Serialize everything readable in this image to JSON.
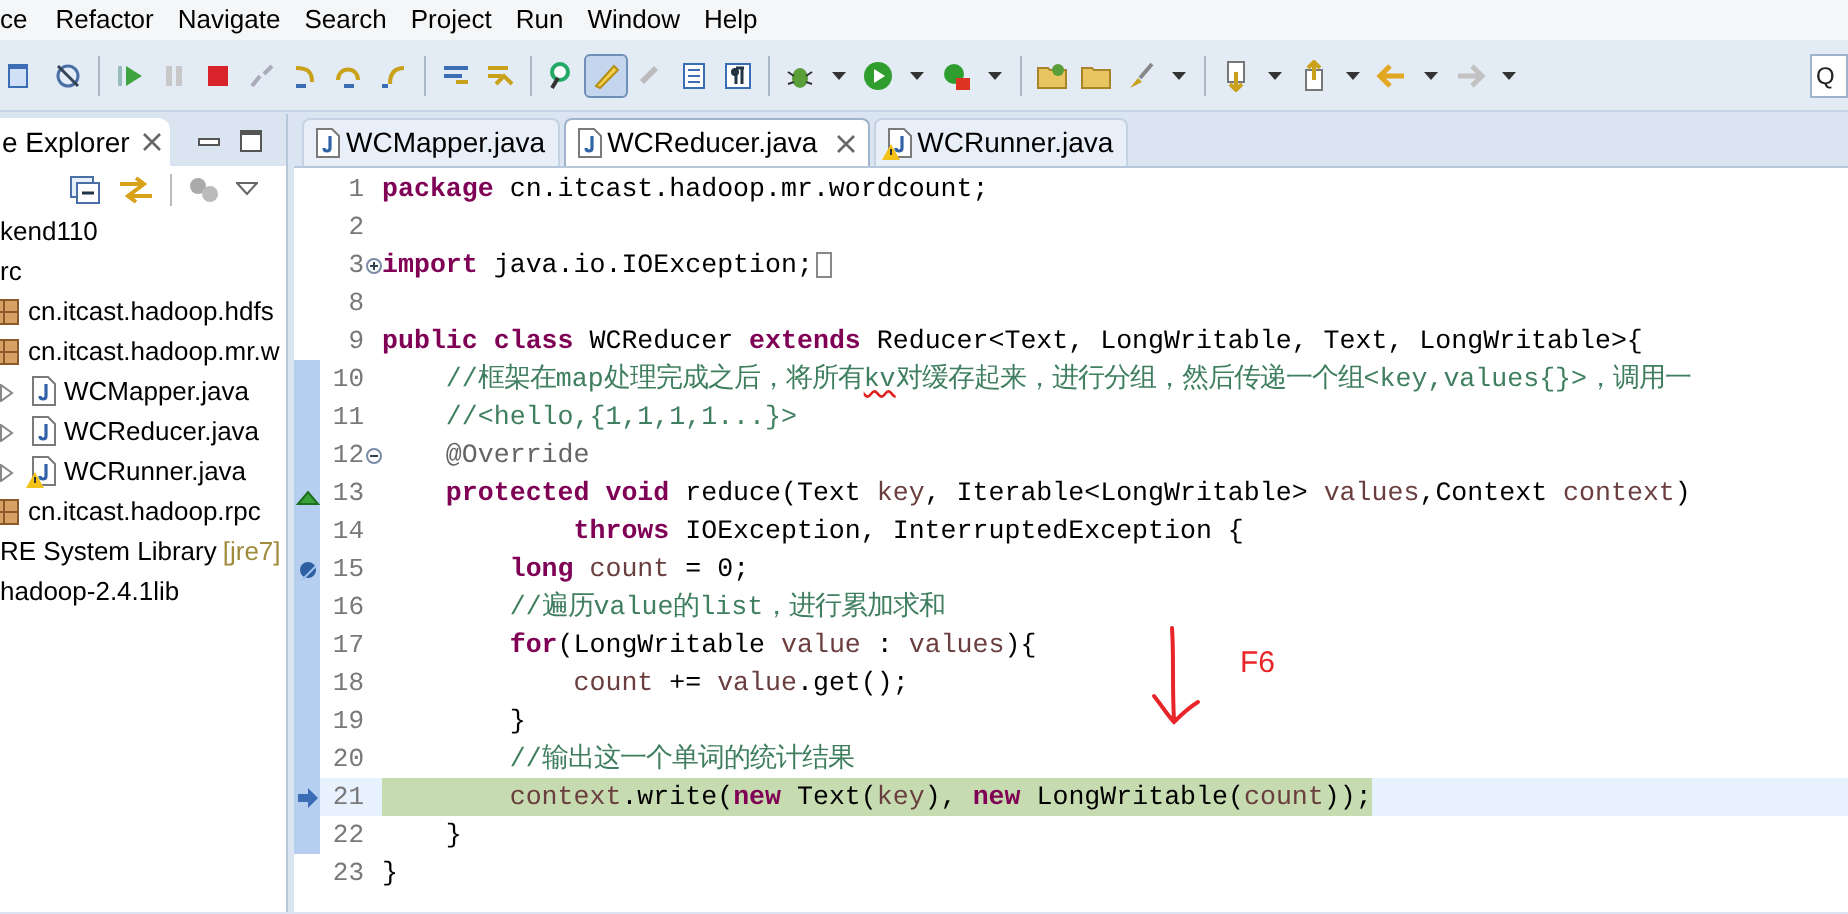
{
  "menu": [
    "ce",
    "Refactor",
    "Navigate",
    "Search",
    "Project",
    "Run",
    "Window",
    "Help"
  ],
  "toolbar": [
    {
      "selected": false
    },
    {
      "selected": false
    },
    {
      "selected": false
    },
    {
      "selected": false
    },
    {
      "selected": false
    },
    {
      "selected": false
    },
    {
      "selected": false
    },
    {
      "selected": false
    },
    {
      "selected": false
    },
    {
      "selected": false
    },
    {
      "selected": false
    },
    {
      "selected": false
    },
    {
      "selected": true
    },
    {
      "selected": false
    },
    {
      "selected": false
    },
    {
      "selected": false
    },
    {
      "selected": false
    },
    {
      "selected": false
    },
    {
      "selected": false
    },
    {
      "selected": false
    },
    {
      "selected": false
    },
    {
      "selected": false
    },
    {
      "selected": false
    },
    {
      "selected": false
    },
    {
      "selected": false
    },
    {
      "selected": false
    }
  ],
  "quick_access": {
    "placeholder": "Q"
  },
  "explorer": {
    "title": "e Explorer",
    "tree": [
      {
        "label": "kend110",
        "children": [
          {
            "label": "rc",
            "children": [
              {
                "label": "cn.itcast.hadoop.hdfs",
                "kind": "package"
              },
              {
                "label": "cn.itcast.hadoop.mr.w",
                "kind": "package",
                "children": [
                  {
                    "label": "WCMapper.java",
                    "kind": "file",
                    "expanded": false,
                    "warning": false
                  },
                  {
                    "label": "WCReducer.java",
                    "kind": "file",
                    "expanded": false,
                    "warning": false
                  },
                  {
                    "label": "WCRunner.java",
                    "kind": "file",
                    "expanded": false,
                    "warning": true
                  }
                ]
              },
              {
                "label": "cn.itcast.hadoop.rpc",
                "kind": "package"
              }
            ]
          },
          {
            "label": "RE System Library",
            "decoration": "[jre7]"
          },
          {
            "label": "hadoop-2.4.1lib"
          }
        ]
      }
    ]
  },
  "editor_tabs": [
    {
      "label": "WCMapper.java",
      "selected": false,
      "warning": false
    },
    {
      "label": "WCReducer.java",
      "selected": true,
      "warning": false
    },
    {
      "label": "WCRunner.java",
      "selected": false,
      "warning": true
    }
  ],
  "code_lines": [
    {
      "number": "1",
      "kind": "plain",
      "changed": false,
      "current": false,
      "segments": [
        {
          "kind": "keyword",
          "text": "package"
        },
        {
          "kind": "plain",
          "text": " cn.itcast.hadoop.mr.wordcount;"
        }
      ]
    },
    {
      "number": "2",
      "kind": "plain",
      "changed": false,
      "current": false
    },
    {
      "number": "3",
      "kind": "plain",
      "changed": false,
      "current": false,
      "collapsed": true,
      "segments": [
        {
          "kind": "keyword",
          "text": "import"
        },
        {
          "kind": "plain",
          "text": " java.io.IOException;"
        }
      ]
    },
    {
      "number": "8",
      "kind": "plain",
      "changed": false,
      "current": false
    },
    {
      "number": "9",
      "kind": "plain",
      "changed": false,
      "current": false,
      "segments": [
        {
          "kind": "keyword",
          "text": "public class"
        },
        {
          "kind": "plain",
          "text": " WCReducer "
        },
        {
          "kind": "keyword",
          "text": "extends"
        },
        {
          "kind": "plain",
          "text": " Reducer<Text, LongWritable, Text, LongWritable>{"
        }
      ]
    },
    {
      "number": "10",
      "kind": "plain",
      "changed": true,
      "current": false,
      "segments": [
        {
          "kind": "comment",
          "text": "    //框架在map处理完成之后，将所有"
        },
        {
          "kind": "misspelled",
          "text": "kv"
        },
        {
          "kind": "comment",
          "text": "对缓存起来，进行分组，然后传递一个组<key,values{}>，调用一"
        }
      ]
    },
    {
      "number": "11",
      "kind": "plain",
      "changed": true,
      "current": false,
      "segments": [
        {
          "kind": "comment",
          "text": "    //<hello,{1,1,1,1...}>"
        }
      ]
    },
    {
      "number": "12",
      "kind": "plain",
      "changed": true,
      "current": false,
      "collapsed": false,
      "segments": [
        {
          "kind": "annotation",
          "text": "    @Override"
        }
      ]
    },
    {
      "number": "13",
      "kind": "override",
      "changed": true,
      "current": false,
      "segments": [
        {
          "kind": "keyword",
          "text": "    protected void"
        },
        {
          "kind": "plain",
          "text": " reduce(Text "
        },
        {
          "kind": "variable",
          "text": "key"
        },
        {
          "kind": "plain",
          "text": ", Iterable<LongWritable> "
        },
        {
          "kind": "variable",
          "text": "values"
        },
        {
          "kind": "plain",
          "text": ",Context "
        },
        {
          "kind": "variable",
          "text": "context"
        },
        {
          "kind": "plain",
          "text": ")"
        }
      ]
    },
    {
      "number": "14",
      "kind": "plain",
      "changed": true,
      "current": false,
      "segments": [
        {
          "kind": "keyword",
          "text": "            throws"
        },
        {
          "kind": "plain",
          "text": " IOException, InterruptedException {"
        }
      ]
    },
    {
      "number": "15",
      "kind": "breakpoint",
      "changed": true,
      "current": false,
      "segments": [
        {
          "kind": "keyword",
          "text": "        long"
        },
        {
          "kind": "variable",
          "text": " count"
        },
        {
          "kind": "plain",
          "text": " = 0;"
        }
      ]
    },
    {
      "number": "16",
      "kind": "plain",
      "changed": true,
      "current": false,
      "segments": [
        {
          "kind": "comment",
          "text": "        //遍历value的list，进行累加求和"
        }
      ]
    },
    {
      "number": "17",
      "kind": "plain",
      "changed": true,
      "current": false,
      "segments": [
        {
          "kind": "keyword",
          "text": "        for"
        },
        {
          "kind": "plain",
          "text": "(LongWritable "
        },
        {
          "kind": "variable",
          "text": "value"
        },
        {
          "kind": "plain",
          "text": " : "
        },
        {
          "kind": "variable",
          "text": "values"
        },
        {
          "kind": "plain",
          "text": "){"
        }
      ]
    },
    {
      "number": "18",
      "kind": "plain",
      "changed": true,
      "current": false,
      "segments": [
        {
          "kind": "variable",
          "text": "            count"
        },
        {
          "kind": "plain",
          "text": " += "
        },
        {
          "kind": "variable",
          "text": "value"
        },
        {
          "kind": "plain",
          "text": ".get();"
        }
      ]
    },
    {
      "number": "19",
      "kind": "plain",
      "changed": true,
      "current": false,
      "segments": [
        {
          "kind": "plain",
          "text": "        }"
        }
      ]
    },
    {
      "number": "20",
      "kind": "plain",
      "changed": true,
      "current": false,
      "segments": [
        {
          "kind": "comment",
          "text": "        //输出这一个单词的统计结果"
        }
      ]
    },
    {
      "number": "21",
      "kind": "instruction-pointer",
      "changed": true,
      "current": true,
      "segments": [
        {
          "kind": "variable",
          "text": "        context"
        },
        {
          "kind": "plain",
          "text": ".write("
        },
        {
          "kind": "keyword",
          "text": "new"
        },
        {
          "kind": "plain",
          "text": " Text("
        },
        {
          "kind": "variable",
          "text": "key"
        },
        {
          "kind": "plain",
          "text": "), "
        },
        {
          "kind": "keyword",
          "text": "new"
        },
        {
          "kind": "plain",
          "text": " LongWritable("
        },
        {
          "kind": "variable",
          "text": "count"
        },
        {
          "kind": "plain",
          "text": "));"
        }
      ]
    },
    {
      "number": "22",
      "kind": "plain",
      "changed": true,
      "current": false,
      "segments": [
        {
          "kind": "plain",
          "text": "    }"
        }
      ]
    },
    {
      "number": "23",
      "kind": "plain",
      "changed": false,
      "current": false,
      "segments": [
        {
          "kind": "plain",
          "text": "}"
        }
      ]
    }
  ],
  "annotation": {
    "text": "F6"
  }
}
